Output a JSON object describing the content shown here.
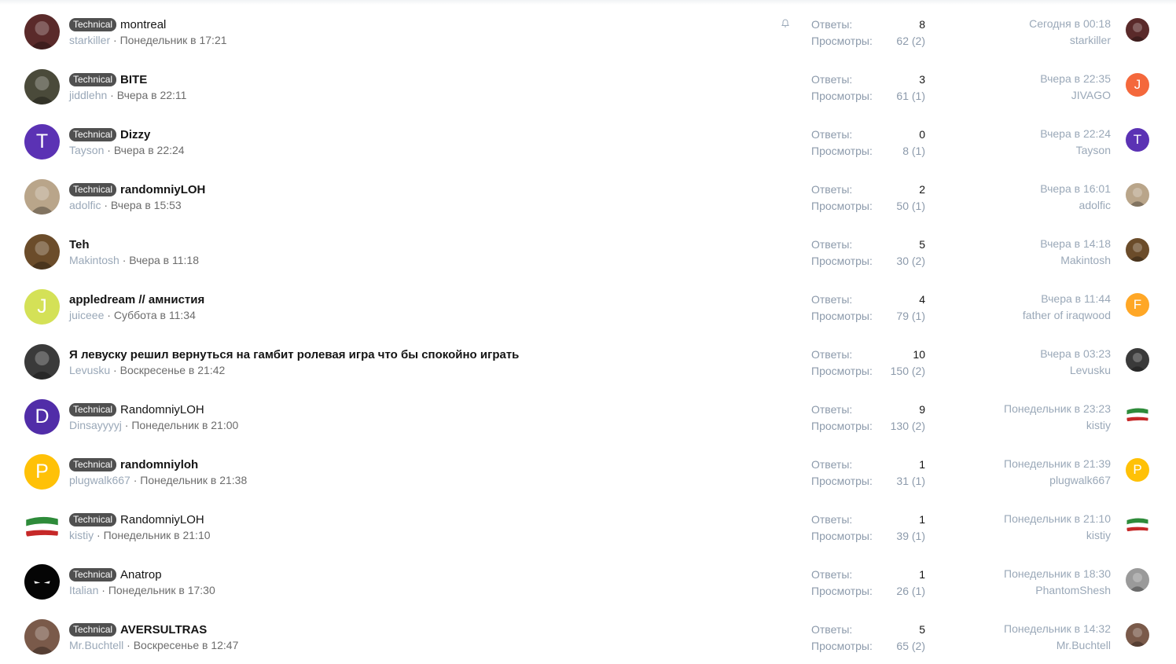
{
  "labels": {
    "replies": "Ответы:",
    "views": "Просмотры:"
  },
  "threads": [
    {
      "prefix": "Technical",
      "title": "montreal",
      "bold": false,
      "author": "starkiller",
      "date": "Понедельник в 17:21",
      "replies": "8",
      "views": "62 (2)",
      "last_time": "Сегодня в 00:18",
      "last_user": "starkiller",
      "watched": true,
      "avatar": {
        "type": "photo",
        "color": "#5a2a2a"
      },
      "mini": {
        "type": "photo",
        "color": "#5a2a2a"
      }
    },
    {
      "prefix": "Technical",
      "title": "BITE",
      "bold": true,
      "author": "jiddlehn",
      "date": "Вчера в 22:11",
      "replies": "3",
      "views": "61 (1)",
      "last_time": "Вчера в 22:35",
      "last_user": "JIVAGO",
      "avatar": {
        "type": "photo",
        "color": "#4a4a3a"
      },
      "mini": {
        "type": "letter",
        "letter": "J",
        "color": "#f4683c"
      }
    },
    {
      "prefix": "Technical",
      "title": "Dizzy",
      "bold": true,
      "author": "Tayson",
      "date": "Вчера в 22:24",
      "replies": "0",
      "views": "8 (1)",
      "last_time": "Вчера в 22:24",
      "last_user": "Tayson",
      "avatar": {
        "type": "letter",
        "letter": "T",
        "color": "#5b32b4"
      },
      "mini": {
        "type": "letter",
        "letter": "T",
        "color": "#5b32b4"
      }
    },
    {
      "prefix": "Technical",
      "title": "randomniyLOH",
      "bold": true,
      "author": "adolfic",
      "date": "Вчера в 15:53",
      "replies": "2",
      "views": "50 (1)",
      "last_time": "Вчера в 16:01",
      "last_user": "adolfic",
      "avatar": {
        "type": "photo",
        "color": "#b9a58a"
      },
      "mini": {
        "type": "photo",
        "color": "#b9a58a"
      }
    },
    {
      "prefix": "",
      "title": "Teh",
      "bold": true,
      "author": "Makintosh",
      "date": "Вчера в 11:18",
      "replies": "5",
      "views": "30 (2)",
      "last_time": "Вчера в 14:18",
      "last_user": "Makintosh",
      "avatar": {
        "type": "photo",
        "color": "#6b4c2a"
      },
      "mini": {
        "type": "photo",
        "color": "#6b4c2a"
      }
    },
    {
      "prefix": "",
      "title": "appledream // амнистия",
      "bold": true,
      "author": "juiceee",
      "date": "Суббота в 11:34",
      "replies": "4",
      "views": "79 (1)",
      "last_time": "Вчера в 11:44",
      "last_user": "father of iraqwood",
      "avatar": {
        "type": "letter",
        "letter": "J",
        "color": "#d4e157"
      },
      "mini": {
        "type": "letter",
        "letter": "F",
        "color": "#ffa726"
      }
    },
    {
      "prefix": "",
      "title": "Я левуску решил вернуться на гамбит ролевая игра что бы спокойно играть",
      "bold": true,
      "author": "Levusku",
      "date": "Воскресенье в 21:42",
      "replies": "10",
      "views": "150 (2)",
      "last_time": "Вчера в 03:23",
      "last_user": "Levusku",
      "avatar": {
        "type": "photo",
        "color": "#3a3a3a"
      },
      "mini": {
        "type": "photo",
        "color": "#3a3a3a"
      }
    },
    {
      "prefix": "Technical",
      "title": "RandomniyLOH",
      "bold": false,
      "author": "Dinsayyyyj",
      "date": "Понедельник в 21:00",
      "replies": "9",
      "views": "130 (2)",
      "last_time": "Понедельник в 23:23",
      "last_user": "kistiy",
      "avatar": {
        "type": "letter",
        "letter": "D",
        "color": "#512da8"
      },
      "mini": {
        "type": "flag"
      }
    },
    {
      "prefix": "Technical",
      "title": "randomniyloh",
      "bold": true,
      "author": "plugwalk667",
      "date": "Понедельник в 21:38",
      "replies": "1",
      "views": "31 (1)",
      "last_time": "Понедельник в 21:39",
      "last_user": "plugwalk667",
      "avatar": {
        "type": "letter",
        "letter": "P",
        "color": "#ffc107"
      },
      "mini": {
        "type": "letter",
        "letter": "P",
        "color": "#ffc107"
      }
    },
    {
      "prefix": "Technical",
      "title": "RandomniyLOH",
      "bold": false,
      "author": "kistiy",
      "date": "Понедельник в 21:10",
      "replies": "1",
      "views": "39 (1)",
      "last_time": "Понедельник в 21:10",
      "last_user": "kistiy",
      "avatar": {
        "type": "flag"
      },
      "mini": {
        "type": "flag"
      }
    },
    {
      "prefix": "Technical",
      "title": "Anatrop",
      "bold": false,
      "author": "Italian",
      "date": "Понедельник в 17:30",
      "replies": "1",
      "views": "26 (1)",
      "last_time": "Понедельник в 18:30",
      "last_user": "PhantomShesh",
      "avatar": {
        "type": "eyes"
      },
      "mini": {
        "type": "photo",
        "color": "#9a9a9a"
      }
    },
    {
      "prefix": "Technical",
      "title": "AVERSULTRAS",
      "bold": true,
      "author": "Mr.Buchtell",
      "date": "Воскресенье в 12:47",
      "replies": "5",
      "views": "65 (2)",
      "last_time": "Понедельник в 14:32",
      "last_user": "Mr.Buchtell",
      "avatar": {
        "type": "photo",
        "color": "#7a5a4a"
      },
      "mini": {
        "type": "photo",
        "color": "#7a5a4a"
      }
    }
  ]
}
